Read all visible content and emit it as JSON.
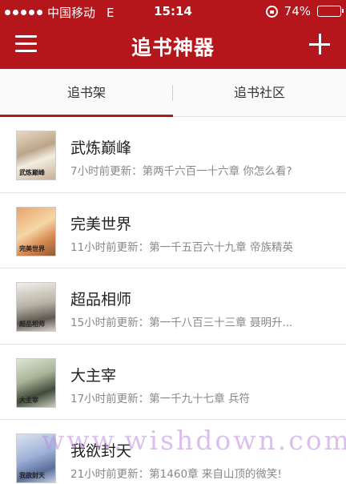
{
  "status_bar": {
    "carrier": "中国移动",
    "network": "E",
    "time": "15:14",
    "battery": "74%",
    "battery_level": 0.74
  },
  "header": {
    "title": "追书神器",
    "menu_icon": "hamburger-menu-icon",
    "add_icon": "plus-icon"
  },
  "tabs": [
    {
      "label": "追书架",
      "active": true
    },
    {
      "label": "追书社区",
      "active": false
    }
  ],
  "books": [
    {
      "title": "武炼巅峰",
      "update": "7小时前更新：第两千六百一十六章 你怎么看?",
      "cover_text": "武炼巅峰"
    },
    {
      "title": "完美世界",
      "update": "11小时前更新：第一千五百六十九章 帝族精英",
      "cover_text": "完美世界"
    },
    {
      "title": "超品相师",
      "update": "15小时前更新：第一千八百三十三章 聂明升...",
      "cover_text": "超品相师"
    },
    {
      "title": "大主宰",
      "update": "17小时前更新：第一千九十七章 兵符",
      "cover_text": "大主宰"
    },
    {
      "title": "我欲封天",
      "update": "21小时前更新：第1460章 来自山顶的微笑!",
      "cover_text": "我欲封天"
    }
  ],
  "watermark": "www.wishdown.com",
  "colors": {
    "accent": "#b5161b"
  }
}
